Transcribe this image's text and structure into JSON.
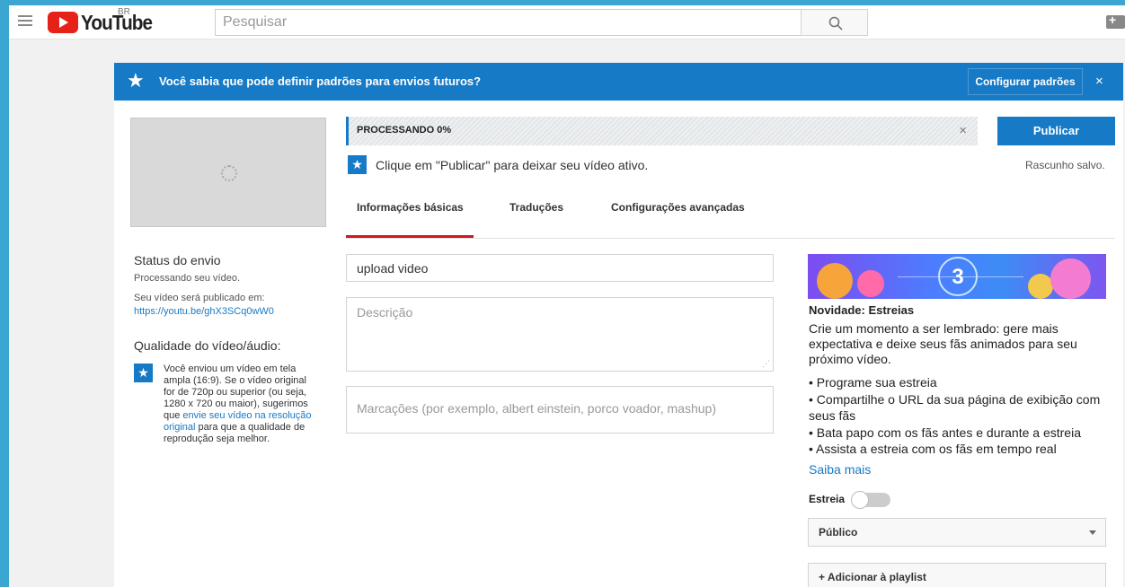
{
  "header": {
    "logo_text": "YouTube",
    "region": "BR",
    "search_placeholder": "Pesquisar"
  },
  "banner": {
    "text": "Você sabia que pode definir padrões para envios futuros?",
    "config_button": "Configurar padrões",
    "close": "×"
  },
  "upload": {
    "progress_label": "PROCESSANDO 0%",
    "progress_value": 0,
    "progress_close": "×",
    "publish_button": "Publicar",
    "draft_status": "Rascunho salvo.",
    "hint": "Clique em \"Publicar\" para deixar seu vídeo ativo."
  },
  "tabs": [
    {
      "label": "Informações básicas",
      "active": true
    },
    {
      "label": "Traduções",
      "active": false
    },
    {
      "label": "Configurações avançadas",
      "active": false
    }
  ],
  "sidebar": {
    "status_title": "Status do envio",
    "status_text": "Processando seu vídeo.",
    "publish_at_label": "Seu vídeo será publicado em:",
    "video_url": "https://youtu.be/ghX3SCq0wW0",
    "quality_title": "Qualidade do vídeo/áudio:",
    "quality_text_1": "Você enviou um vídeo em tela ampla (16:9). Se o vídeo original for de 720p ou superior (ou seja, 1280 x 720 ou maior), sugerimos que",
    "quality_link": "envie seu vídeo na resolução original",
    "quality_text_2": "para que a qualidade de reprodução seja melhor."
  },
  "form": {
    "title_value": "upload video",
    "description_placeholder": "Descrição",
    "tags_placeholder": "Marcações (por exemplo, albert einstein, porco voador, mashup)"
  },
  "premiere": {
    "countdown": "3",
    "title": "Novidade: Estreias",
    "body": "Crie um momento a ser lembrado: gere mais expectativa e deixe seus fãs animados para seu próximo vídeo.",
    "bullets": [
      "• Programe sua estreia",
      "• Compartilhe o URL da sua página de exibição com seus fãs",
      "• Bata papo com os fãs antes e durante a estreia",
      "• Assista a estreia com os fãs em tempo real"
    ],
    "learn_more": "Saiba mais",
    "toggle_label": "Estreia",
    "toggle_on": false
  },
  "visibility": {
    "selected": "Público"
  },
  "playlist": {
    "button": "+ Adicionar à playlist"
  },
  "colors": {
    "accent": "#167ac6",
    "tab_active": "#cc181e",
    "brand_red": "#e62117"
  }
}
